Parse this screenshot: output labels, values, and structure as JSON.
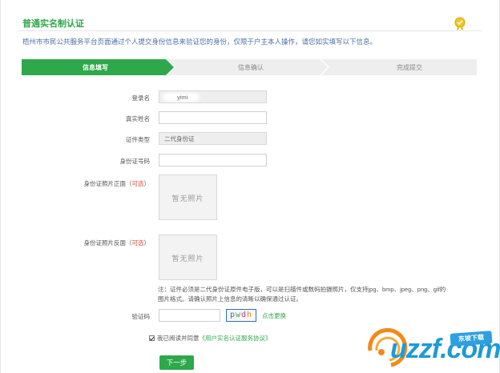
{
  "header": {
    "title": "普通实名制认证",
    "description": "梧州市市民公共服务平台页面通过个人提交身份信息来验证您的身份，仅限于户主本人操作，请您如实填写以下信息。"
  },
  "steps": [
    {
      "label": "信息填写",
      "active": true
    },
    {
      "label": "信息确认",
      "active": false
    },
    {
      "label": "完成提交",
      "active": false
    }
  ],
  "form": {
    "login_label": "登录名",
    "login_value": "yimi",
    "realname_label": "真实姓名",
    "realname_value": "",
    "idtype_label": "证件类型",
    "idtype_value": "二代身份证",
    "idnum_label": "身份证号码",
    "idnum_value": "",
    "front_label": "身份证照片正面（",
    "front_optional": "可选",
    "front_close": "）",
    "back_label": "身份证照片反面（",
    "back_optional": "可选",
    "back_close": "）",
    "no_photo": "暂无照片",
    "note": "注：证件必须是二代身份证原件电子版，可以是扫描件或数码拍摄照片，仅支持jpg、bmp、jpeg、png、gif的图片格式。请确认照片上信息的清晰以确保通过认证。",
    "captcha_label": "验证码",
    "captcha_value": "",
    "captcha_text": "pwdh",
    "refresh_text": "点击更换",
    "agree_prefix": "我已阅读并同意",
    "agree_link": "《用户实名认证服务协议》",
    "next_button": "下一步"
  },
  "watermark": {
    "brand": "uzzf.com",
    "badge": "东坡下载"
  },
  "colors": {
    "accent": "#2ea84a",
    "step_inactive": "#eeeeee",
    "optional": "#e34b3b",
    "description": "#4a6fa5"
  }
}
